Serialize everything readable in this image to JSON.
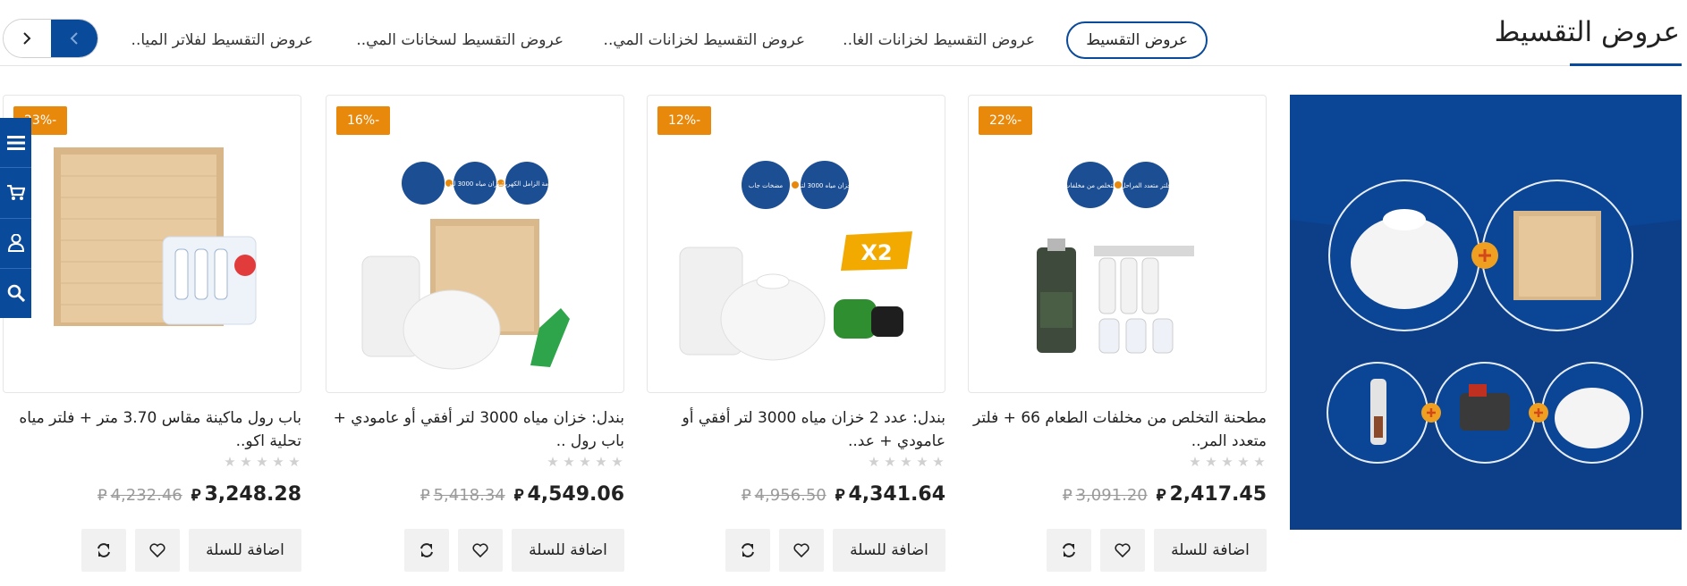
{
  "section": {
    "title": "عروض التقسيط"
  },
  "tabs": [
    {
      "label": "عروض التقسيط",
      "active": true
    },
    {
      "label": "عروض التقسيط لخزانات الغا..",
      "active": false
    },
    {
      "label": "عروض التقسيط لخزانات المي..",
      "active": false
    },
    {
      "label": "عروض التقسيط لسخانات المي..",
      "active": false
    },
    {
      "label": "عروض التقسيط لفلاتر الميا..",
      "active": false
    }
  ],
  "carousel_nav": {
    "next_icon": "chevron-right-icon",
    "prev_icon": "chevron-left-icon"
  },
  "products": [
    {
      "discount": "22%-",
      "title": "مطحنة التخلص من مخلفات الطعام 66 + فلتر متعدد المر..",
      "old_price": "3,091.20",
      "price": "2,417.45",
      "rating": 0,
      "add_to_cart": "اضافة للسلة",
      "image_labels": [
        "فلتر متعدد المراحل",
        "مطحنة التخلص من مخلفات الطعام"
      ]
    },
    {
      "discount": "12%-",
      "title": "بندل: عدد 2 خزان مياه 3000 لتر أفقي أو عامودي + عد..",
      "old_price": "4,956.50",
      "price": "4,341.64",
      "rating": 0,
      "add_to_cart": "اضافة للسلة",
      "image_labels": [
        "خزان مياه 3000 لتر",
        "مضخات جاب"
      ],
      "image_mark": "X2"
    },
    {
      "discount": "16%-",
      "title": "بندل: خزان مياه 3000 لتر أفقي أو عامودي + باب رول ..",
      "old_price": "5,418.34",
      "price": "4,549.06",
      "rating": 0,
      "add_to_cart": "اضافة للسلة",
      "image_labels": [
        "عوامة الزامل الكهربائية",
        "خزان مياه 3000 لتر",
        "باب رول"
      ]
    },
    {
      "discount": "23%-",
      "title": "باب رول ماكينة مقاس 3.70 متر + فلتر مياه تحلية اكو..",
      "old_price": "4,232.46",
      "price": "3,248.28",
      "rating": 0,
      "add_to_cart": "اضافة للسلة"
    }
  ],
  "currency_symbol": "⃁",
  "product_action_icons": {
    "wishlist": "heart-icon",
    "compare": "refresh-icon"
  },
  "side_menu": [
    {
      "name": "menu",
      "icon": "list-icon"
    },
    {
      "name": "cart",
      "icon": "cart-icon"
    },
    {
      "name": "account",
      "icon": "user-icon"
    },
    {
      "name": "search",
      "icon": "search-icon"
    }
  ],
  "colors": {
    "brand_blue": "#0a4a9a",
    "badge_orange": "#e8890c",
    "banner_blue": "#0b4596"
  }
}
